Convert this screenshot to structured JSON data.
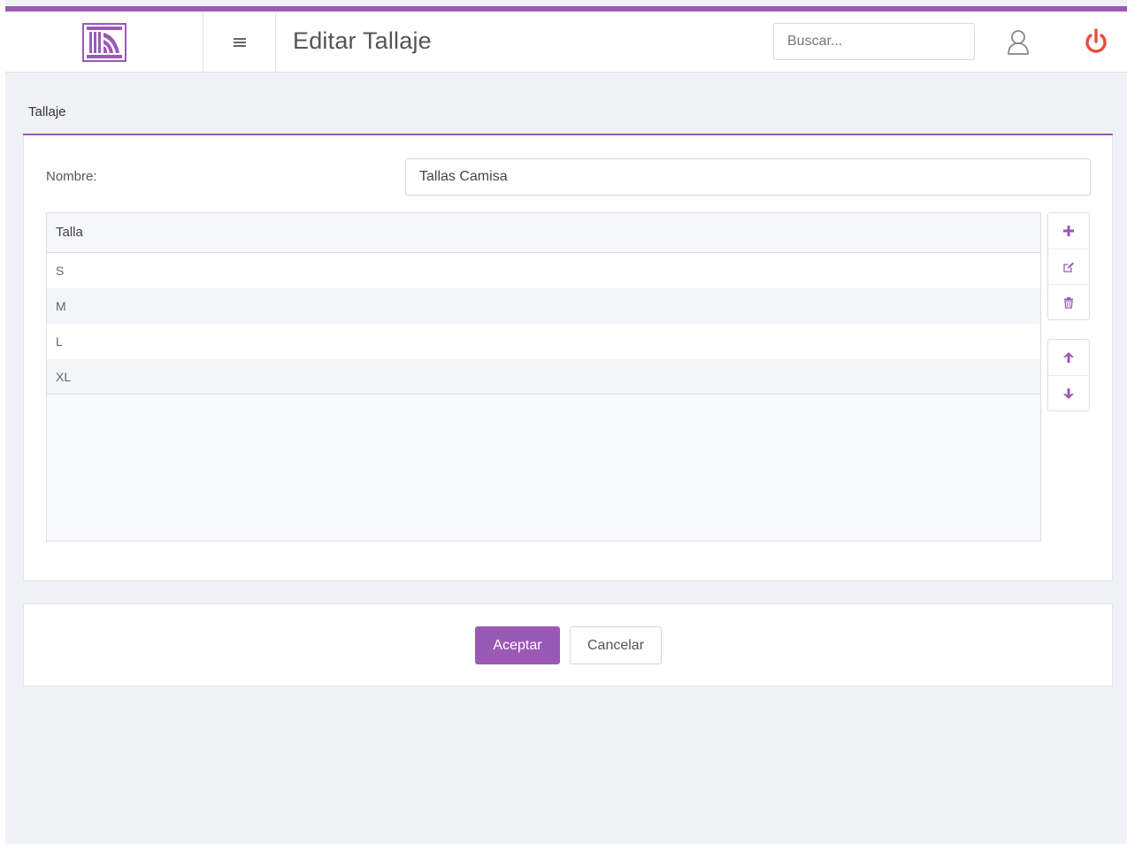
{
  "header": {
    "logo_icon": "building-columns-logo",
    "menu_icon": "hamburger-menu-icon",
    "title": "Editar Tallaje",
    "search_placeholder": "Buscar...",
    "user_icon": "user-icon",
    "power_icon": "power-icon"
  },
  "colors": {
    "accent": "#9b59b6",
    "power": "#e74c3c",
    "background": "#f1f2f7"
  },
  "panel": {
    "title": "Tallaje",
    "name_label": "Nombre:",
    "name_value": "Tallas Camisa"
  },
  "grid": {
    "column_header": "Talla",
    "rows": [
      "S",
      "M",
      "L",
      "XL"
    ]
  },
  "toolbar": {
    "add_icon": "plus-icon",
    "edit_icon": "edit-icon",
    "delete_icon": "trash-icon",
    "move_up_icon": "arrow-up-icon",
    "move_down_icon": "arrow-down-icon"
  },
  "actions": {
    "accept": "Aceptar",
    "cancel": "Cancelar"
  }
}
